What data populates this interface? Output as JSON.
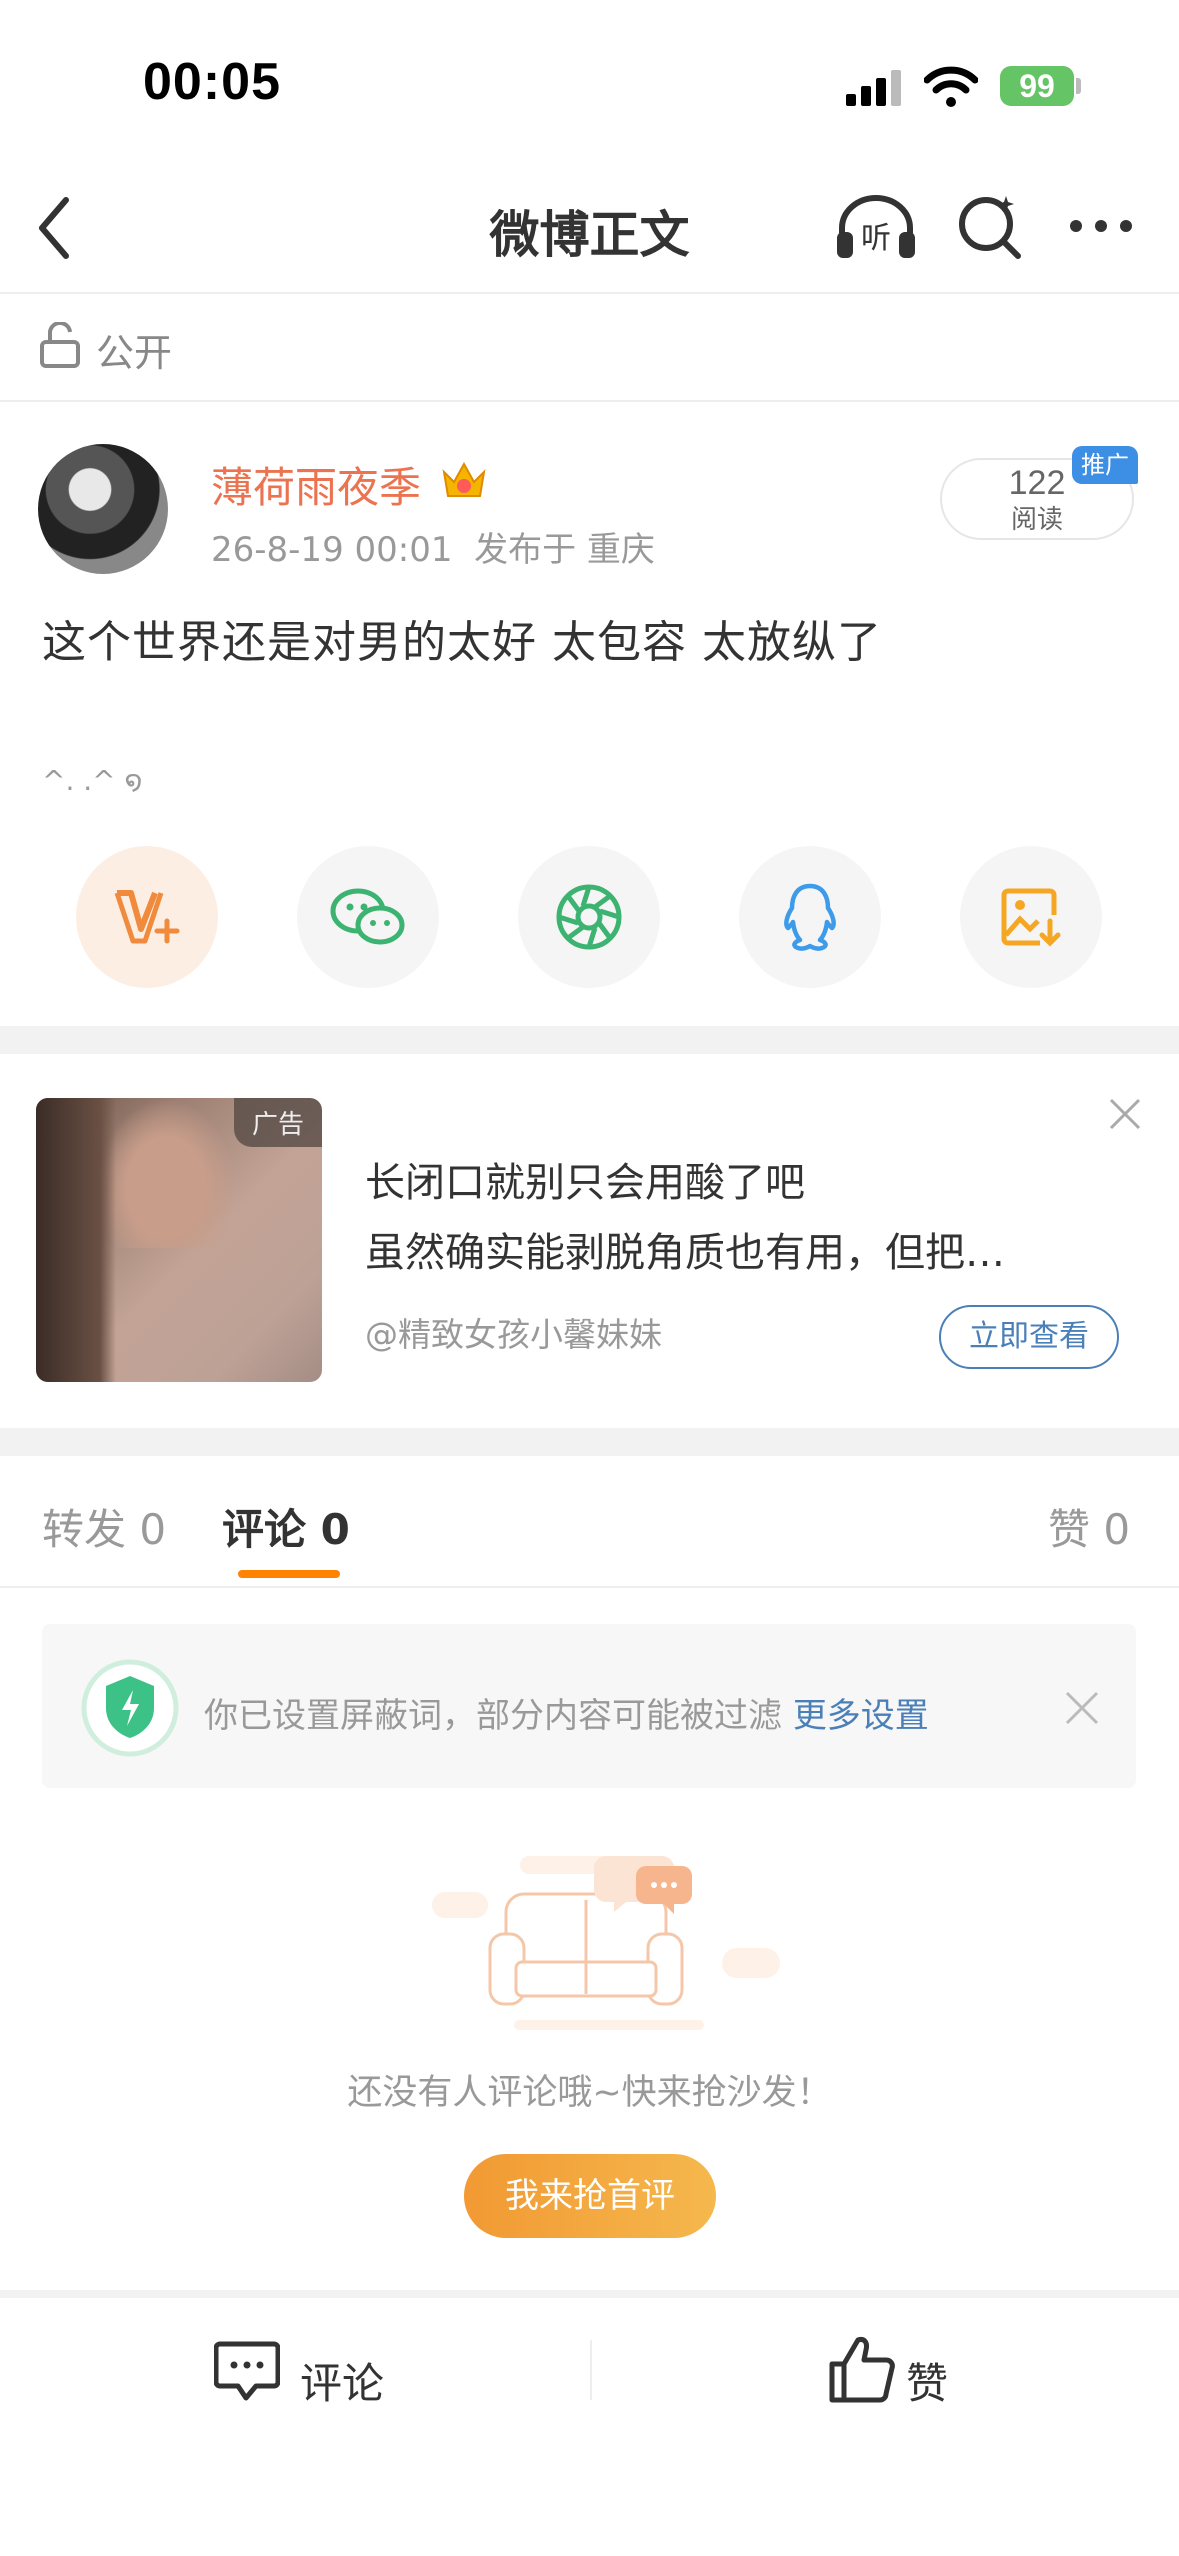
{
  "status_bar": {
    "time": "00:05",
    "battery": "99"
  },
  "nav": {
    "title": "微博正文"
  },
  "visibility": {
    "label": "公开"
  },
  "post": {
    "username": "薄荷雨夜季",
    "timestamp": "26-8-19 00:01",
    "location": "发布于 重庆",
    "read_count": "122",
    "read_label": "阅读",
    "promo_badge": "推广",
    "text": "这个世界还是对男的太好 太包容 太放纵了",
    "emoticon": "^. .^ ໑"
  },
  "share": {
    "items": [
      {
        "icon": "weibo-v-plus-icon",
        "color": "#f08a3c"
      },
      {
        "icon": "wechat-icon",
        "color": "#3cb371"
      },
      {
        "icon": "moments-icon",
        "color": "#3cb371"
      },
      {
        "icon": "qq-icon",
        "color": "#3d9be9"
      },
      {
        "icon": "save-image-icon",
        "color": "#f5a623"
      }
    ]
  },
  "ad": {
    "tag": "广告",
    "title": "长闭口就别只会用酸了吧",
    "body": "虽然确实能剥脱角质也有用，但把…",
    "author": "@精致女孩小馨妹妹",
    "cta": "立即查看"
  },
  "tabs": {
    "repost": "转发 0",
    "comment": "评论 0",
    "like": "赞 0"
  },
  "notice": {
    "text": "你已设置屏蔽词，部分内容可能被过滤 ",
    "link": "更多设置"
  },
  "empty": {
    "text": "还没有人评论哦~快来抢沙发！",
    "button": "我来抢首评"
  },
  "bottom_bar": {
    "comment": "评论",
    "like": "赞"
  },
  "colors": {
    "accent": "#ff8200",
    "username": "#eb7350",
    "link": "#4a7fb8"
  }
}
